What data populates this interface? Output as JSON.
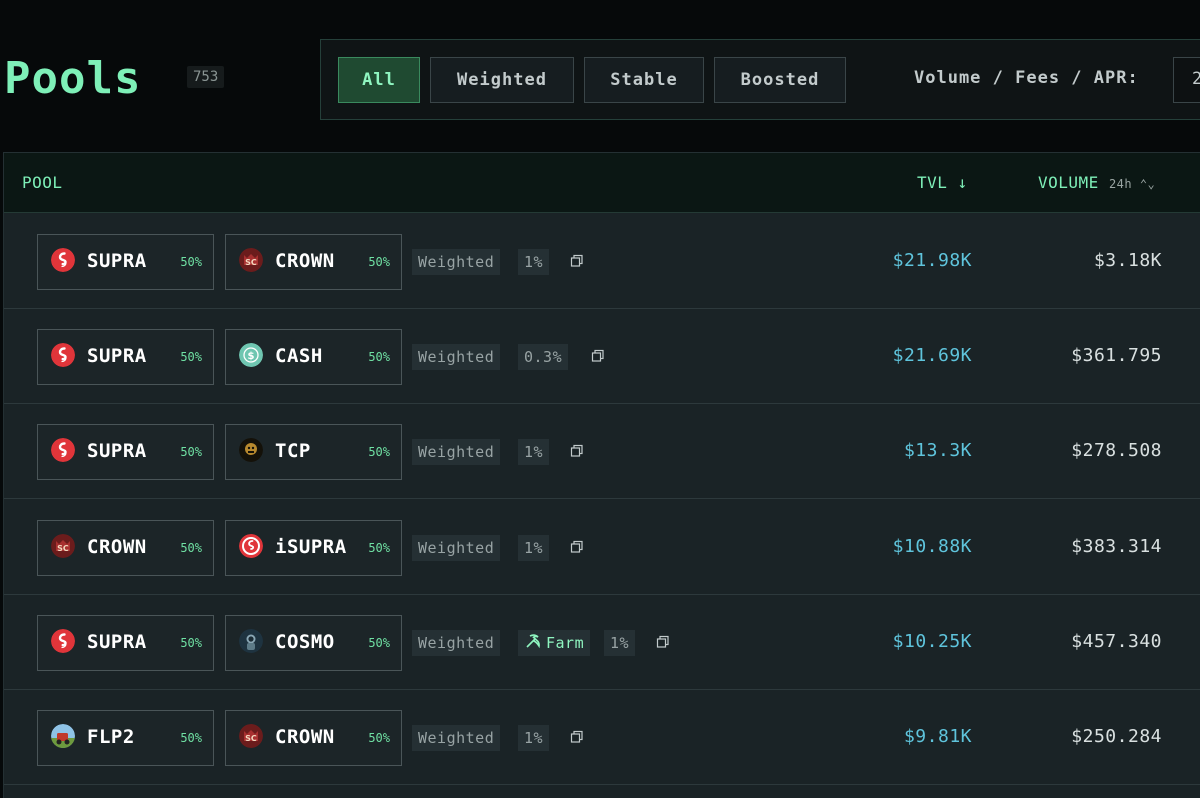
{
  "header": {
    "title": "Pools",
    "count": "753"
  },
  "filters": {
    "tabs": [
      {
        "label": "All",
        "active": true
      },
      {
        "label": "Weighted",
        "active": false
      },
      {
        "label": "Stable",
        "active": false
      },
      {
        "label": "Boosted",
        "active": false
      }
    ],
    "metric_label": "Volume / Fees / APR:",
    "metric_value": "2"
  },
  "table": {
    "columns": {
      "pool": "POOL",
      "tvl": "TVL ↓",
      "volume": "VOLUME",
      "volume_sub": "24h ⌃⌄"
    },
    "rows": [
      {
        "tokens": [
          {
            "symbol": "SUPRA",
            "weight": "50%",
            "icon": "supra-icon"
          },
          {
            "symbol": "CROWN",
            "weight": "50%",
            "icon": "crown-icon"
          }
        ],
        "type": "Weighted",
        "farm": "",
        "fee": "1%",
        "tvl": "$21.98K",
        "volume": "$3.18K"
      },
      {
        "tokens": [
          {
            "symbol": "SUPRA",
            "weight": "50%",
            "icon": "supra-icon"
          },
          {
            "symbol": "CASH",
            "weight": "50%",
            "icon": "cash-icon"
          }
        ],
        "type": "Weighted",
        "farm": "",
        "fee": "0.3%",
        "tvl": "$21.69K",
        "volume": "$361.795"
      },
      {
        "tokens": [
          {
            "symbol": "SUPRA",
            "weight": "50%",
            "icon": "supra-icon"
          },
          {
            "symbol": "TCP",
            "weight": "50%",
            "icon": "tcp-icon"
          }
        ],
        "type": "Weighted",
        "farm": "",
        "fee": "1%",
        "tvl": "$13.3K",
        "volume": "$278.508"
      },
      {
        "tokens": [
          {
            "symbol": "CROWN",
            "weight": "50%",
            "icon": "crown-icon"
          },
          {
            "symbol": "iSUPRA",
            "weight": "50%",
            "icon": "isupra-icon"
          }
        ],
        "type": "Weighted",
        "farm": "",
        "fee": "1%",
        "tvl": "$10.88K",
        "volume": "$383.314"
      },
      {
        "tokens": [
          {
            "symbol": "SUPRA",
            "weight": "50%",
            "icon": "supra-icon"
          },
          {
            "symbol": "COSMO",
            "weight": "50%",
            "icon": "cosmo-icon"
          }
        ],
        "type": "Weighted",
        "farm": "Farm",
        "fee": "1%",
        "tvl": "$10.25K",
        "volume": "$457.340"
      },
      {
        "tokens": [
          {
            "symbol": "FLP2",
            "weight": "50%",
            "icon": "flp2-icon"
          },
          {
            "symbol": "CROWN",
            "weight": "50%",
            "icon": "crown-icon"
          }
        ],
        "type": "Weighted",
        "farm": "",
        "fee": "1%",
        "tvl": "$9.81K",
        "volume": "$250.284"
      }
    ]
  },
  "colors": {
    "accent": "#7ef0b8",
    "tvl": "#5fc4dc",
    "background": "#06090a"
  }
}
